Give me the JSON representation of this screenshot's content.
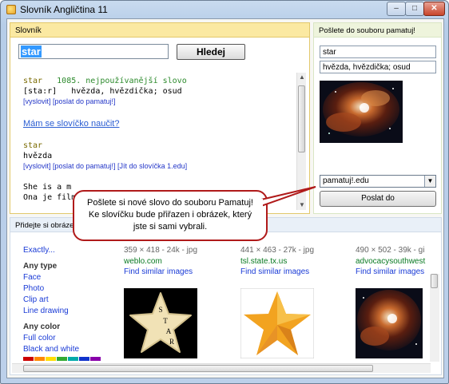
{
  "window": {
    "title": "Slovník Angličtina 11",
    "min": "–",
    "max": "□",
    "close": "✕"
  },
  "slovnik": {
    "header": "Slovník",
    "search_value": "star",
    "search_button": "Hledej",
    "entry1": {
      "word": "star",
      "rank": "1085. nejpoužívanější slovo",
      "pron": "[sta:r]",
      "meaning": "hvězda, hvězdička; osud",
      "links": "[vyslovit] [poslat do pamatuj!]"
    },
    "learn_link": "Mám se slovíčko naučit?",
    "entry2": {
      "word": "star",
      "meaning": "hvězda",
      "links": "[vyslovit] [poslat do pamatuj!] [Jít do slovíčka 1.edu]"
    },
    "sentence1": "She is a m",
    "sentence2": "Ona je film"
  },
  "posli": {
    "header": "Pošlete do souboru pamatuj!",
    "word": "star",
    "meaning": "hvězda, hvězdička; osud",
    "file": "pamatuj!.edu",
    "send_button": "Poslat do"
  },
  "tooltip": "Pošlete si nové slovo do souboru Pamatuj! Ke slovíčku bude přiřazen i obrázek, který jste si sami vybrali.",
  "obrazek": {
    "header": "Přidejte si obrázek",
    "side": {
      "exactly": "Exactly...",
      "type_label": "Any type",
      "types": [
        "Face",
        "Photo",
        "Clip art",
        "Line drawing"
      ],
      "color_label": "Any color",
      "colors": [
        "Full color",
        "Black and white"
      ],
      "swatch_colors": [
        "#cc0000",
        "#ff8800",
        "#ffdd00",
        "#33aa33",
        "#00aaaa",
        "#1133cc",
        "#8800aa"
      ]
    },
    "results": [
      {
        "dims": "359 × 418 - 24k - jpg",
        "site": "weblo.com",
        "find": "Find similar images"
      },
      {
        "dims": "441 × 463 - 27k - jpg",
        "site": "tsl.state.tx.us",
        "find": "Find similar images"
      },
      {
        "dims": "490 × 502 - 39k - gi",
        "site": "advocacysouthwest",
        "find": "Find similar images"
      }
    ],
    "star_letters": [
      "S",
      "T",
      "A",
      "R"
    ]
  }
}
